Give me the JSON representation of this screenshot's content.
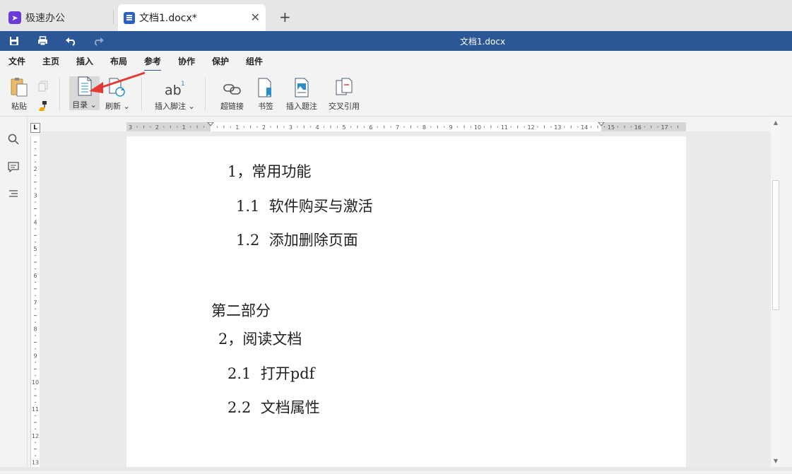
{
  "tabs": {
    "app_label": "极速办公",
    "doc_label": "文档1.docx*"
  },
  "titlebar": {
    "doc_title": "文档1.docx"
  },
  "menu": [
    "文件",
    "主页",
    "插入",
    "布局",
    "参考",
    "协作",
    "保护",
    "组件"
  ],
  "ribbon": {
    "paste": "粘贴",
    "toc": "目录",
    "refresh": "刷新",
    "footnote": "插入脚注",
    "hyperlink": "超链接",
    "bookmark": "书签",
    "caption": "插入题注",
    "crossref": "交叉引用"
  },
  "ruler_corner": "L",
  "document": {
    "lines": [
      "1，常用功能",
      "1.1  软件购买与激活",
      "1.2  添加删除页面",
      "第二部分",
      "2，阅读文档",
      "2.1  打开pdf",
      "2.2  文档属性"
    ]
  },
  "colors": {
    "accent": "#2b5797",
    "annotation_arrow": "#e53935"
  }
}
